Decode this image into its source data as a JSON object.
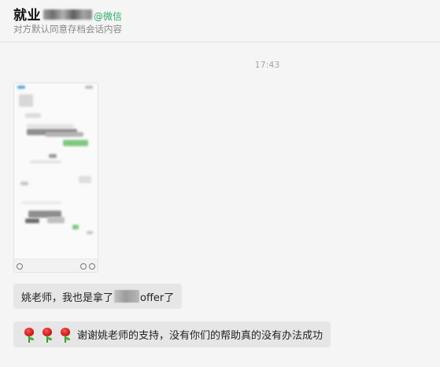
{
  "header": {
    "title": "就业",
    "at_tag": "@微信",
    "subtitle": "对方默认同意存档会话内容"
  },
  "timestamp": "17:43",
  "messages": [
    {
      "type": "image"
    },
    {
      "type": "text",
      "before": "姚老师，我也是拿了",
      "after": "offer了"
    },
    {
      "type": "text",
      "emoji": "rose",
      "emoji_count": 3,
      "text": "谢谢姚老师的支持，没有你们的帮助真的没有办法成功"
    }
  ],
  "colors": {
    "bubble_bg": "#e6e6e6",
    "at_tag": "#2aae67",
    "background": "#f5f5f5"
  }
}
